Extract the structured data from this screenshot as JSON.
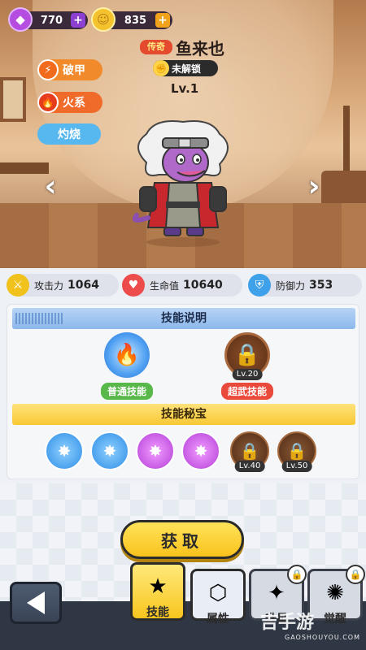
{
  "currency": {
    "gems": "770",
    "coins": "835"
  },
  "hero": {
    "rarity": "传奇",
    "name": "鱼来也",
    "status": "未解锁",
    "level": "Lv.1"
  },
  "tags": {
    "armor": "破甲",
    "element": "火系",
    "effect": "灼烧"
  },
  "stats": {
    "attack_label": "攻击力",
    "attack_value": "1064",
    "hp_label": "生命值",
    "hp_value": "10640",
    "defense_label": "防御力",
    "defense_value": "353"
  },
  "skills": {
    "header": "技能说明",
    "normal_label": "普通技能",
    "ult_label": "超武技能",
    "ult_lock_level": "Lv.20"
  },
  "treasures": {
    "header": "技能秘宝",
    "lock_levels": [
      "Lv.40",
      "Lv.50"
    ]
  },
  "actions": {
    "get": "获取"
  },
  "tabs": {
    "skill": "技能",
    "attr": "属性",
    "tab3": "升星",
    "tab4": "觉醒"
  },
  "watermark": {
    "text": "吉手游",
    "sub": "GAOSHOUYOU.COM"
  },
  "icons": {
    "gem": "gem-icon",
    "coin": "coin-icon",
    "lock": "lock-icon"
  },
  "colors": {
    "accent_yellow": "#f9c21c",
    "panel_blue": "#8cb8ec",
    "fire_red": "#e53c1d"
  }
}
